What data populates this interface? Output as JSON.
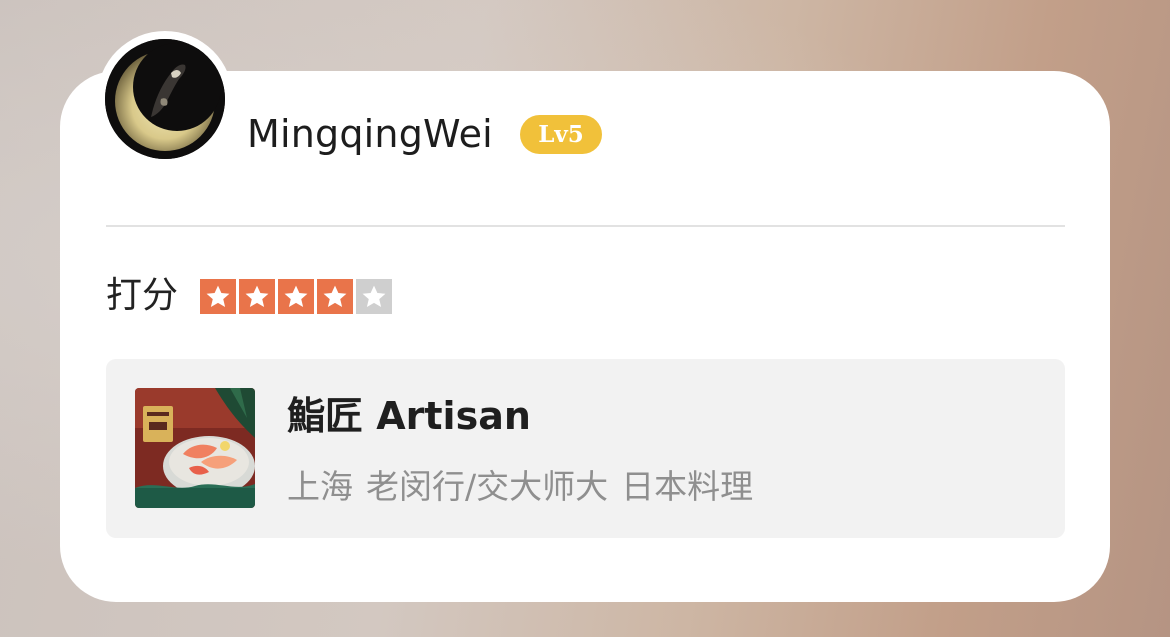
{
  "review": {
    "user": {
      "name": "MingqingWei",
      "level": "Lv5",
      "avatar_icon": "moon-figure-avatar"
    },
    "rating": {
      "label": "打分",
      "value": 4,
      "max": 5,
      "filled_color": "#e9744a",
      "empty_color": "#cfcfcf"
    },
    "shop": {
      "name": "鮨匠 Artisan",
      "city": "上海",
      "district": "老闵行/交大师大",
      "category": "日本料理",
      "image_icon": "sashimi-platter-image"
    }
  },
  "colors": {
    "badge": "#f1c13a",
    "card_background": "#ffffff",
    "shop_card_background": "#f2f2f2"
  }
}
